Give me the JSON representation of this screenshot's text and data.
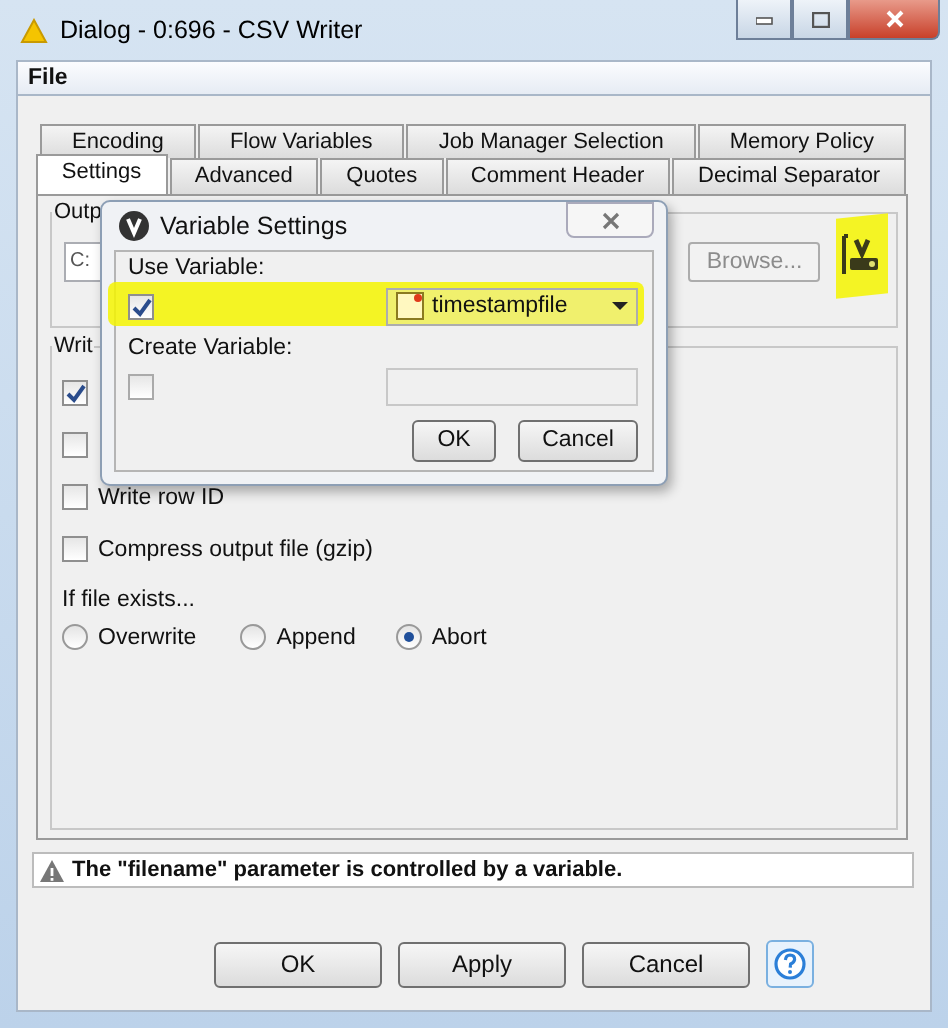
{
  "window": {
    "title": "Dialog - 0:696 - CSV Writer"
  },
  "menu": [
    "File"
  ],
  "tabs_row_1": [
    {
      "label": "Encoding",
      "selected": false
    },
    {
      "label": "Flow Variables",
      "selected": false
    },
    {
      "label": "Job Manager Selection",
      "selected": false
    },
    {
      "label": "Memory Policy",
      "selected": false
    }
  ],
  "tabs_row_2": [
    {
      "label": "Settings",
      "selected": true
    },
    {
      "label": "Advanced",
      "selected": false
    },
    {
      "label": "Quotes",
      "selected": false
    },
    {
      "label": "Comment Header",
      "selected": false
    },
    {
      "label": "Decimal Separator",
      "selected": false
    }
  ],
  "output_group": {
    "legend": "Outp",
    "path": "C:",
    "browse": "Browse..."
  },
  "write_group": {
    "legend": "Writ",
    "options": [
      {
        "checked": true
      },
      {
        "checked": false
      },
      {
        "label": "Write row ID",
        "checked": false
      },
      {
        "label": "Compress output file (gzip)",
        "checked": false
      }
    ]
  },
  "if_exists": {
    "label": "If file exists...",
    "options": [
      {
        "label": "Overwrite",
        "selected": false
      },
      {
        "label": "Append",
        "selected": false
      },
      {
        "label": "Abort",
        "selected": true
      }
    ]
  },
  "warning": "The \"filename\" parameter is controlled by a variable.",
  "buttons": [
    "OK",
    "Apply",
    "Cancel"
  ],
  "variable_dialog": {
    "title": "Variable Settings",
    "use_variable": {
      "label": "Use Variable:",
      "checked": true,
      "value": "timestampfile"
    },
    "create_variable": {
      "label": "Create Variable:",
      "checked": false
    },
    "buttons": [
      "OK",
      "Cancel"
    ]
  }
}
